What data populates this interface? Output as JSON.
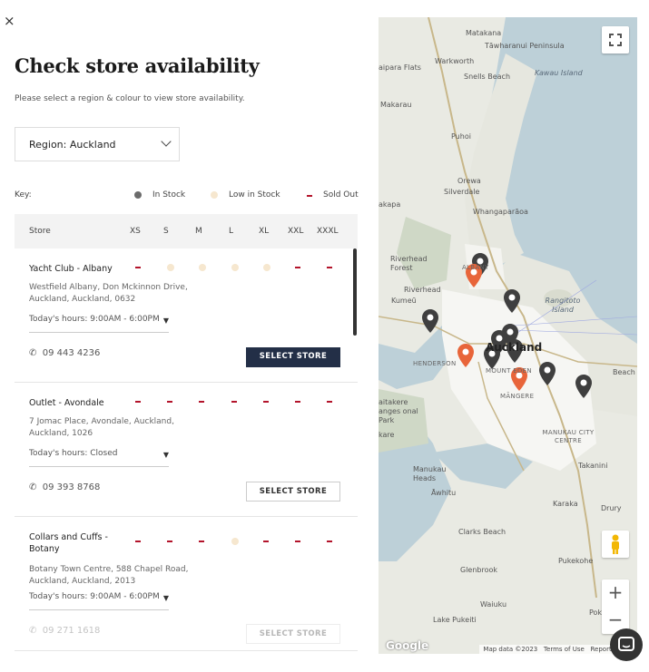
{
  "close_glyph": "×",
  "title": "Check store availability",
  "subtitle": "Please select a region & colour to view store availability.",
  "region_select": "Region: Auckland",
  "key": {
    "label": "Key:",
    "in_stock": "In Stock",
    "low_in_stock": "Low in Stock",
    "sold_out": "Sold Out"
  },
  "colors": {
    "in_stock": "#6b6b6b",
    "low_in_stock": "#f6e7cf",
    "sold_out": "#b3142b",
    "button_dark": "#232f47",
    "pin_orange": "#e8653a",
    "pin_dark": "#3f3f3f"
  },
  "table_header": {
    "store": "Store",
    "sizes": [
      "XS",
      "S",
      "M",
      "L",
      "XL",
      "XXL",
      "XXXL"
    ]
  },
  "stores": [
    {
      "name": "Yacht Club - Albany",
      "address": "Westfield Albany, Don Mckinnon Drive, Auckland, Auckland, 0632",
      "hours": "Today's hours: 9:00AM - 6:00PM",
      "phone": "09 443 4236",
      "button": "SELECT STORE",
      "availability": [
        "sold",
        "low",
        "low",
        "low",
        "low",
        "sold",
        "sold"
      ]
    },
    {
      "name": "Outlet - Avondale",
      "address": "7 Jomac Place, Avondale, Auckland, Auckland, 1026",
      "hours": "Today's hours: Closed",
      "phone": "09 393 8768",
      "button": "SELECT STORE",
      "availability": [
        "sold",
        "sold",
        "sold",
        "sold",
        "sold",
        "sold",
        "sold"
      ]
    },
    {
      "name": "Collars and Cuffs - Botany",
      "address": "Botany Town Centre, 588 Chapel Road, Auckland, Auckland, 2013",
      "hours": "Today's hours: 9:00AM - 6:00PM",
      "phone": "09 271 1618",
      "button": "SELECT STORE",
      "availability": [
        "sold",
        "sold",
        "sold",
        "low",
        "sold",
        "sold",
        "sold"
      ]
    }
  ],
  "map": {
    "places": [
      "Matakana",
      "Tāwharanui Peninsula",
      "Warkworth",
      "Snells Beach",
      "Kawau Island",
      "aipara Flats",
      "Makarau",
      "Puhoi",
      "Orewa",
      "Silverdale",
      "Whangaparāoa",
      "akapa",
      "Riverhead Forest",
      "Albany",
      "Riverhead",
      "Kumeū",
      "Rangitoto Island",
      "Auckland",
      "Henderson",
      "Mount Eden",
      "Beach",
      "aitakere anges onal Park",
      "kare",
      "Māngere",
      "Manukau City Centre",
      "Takanini",
      "Manukau Heads",
      "Āwhitu",
      "Karaka",
      "Drury",
      "Clarks Beach",
      "Glenbrook",
      "Pukekohe",
      "Waiuku",
      "Lake Pukeiti",
      "Pokeno"
    ],
    "google": "Google",
    "attribution": [
      "Map data ©2023",
      "Terms of Use",
      "Report a map"
    ]
  }
}
